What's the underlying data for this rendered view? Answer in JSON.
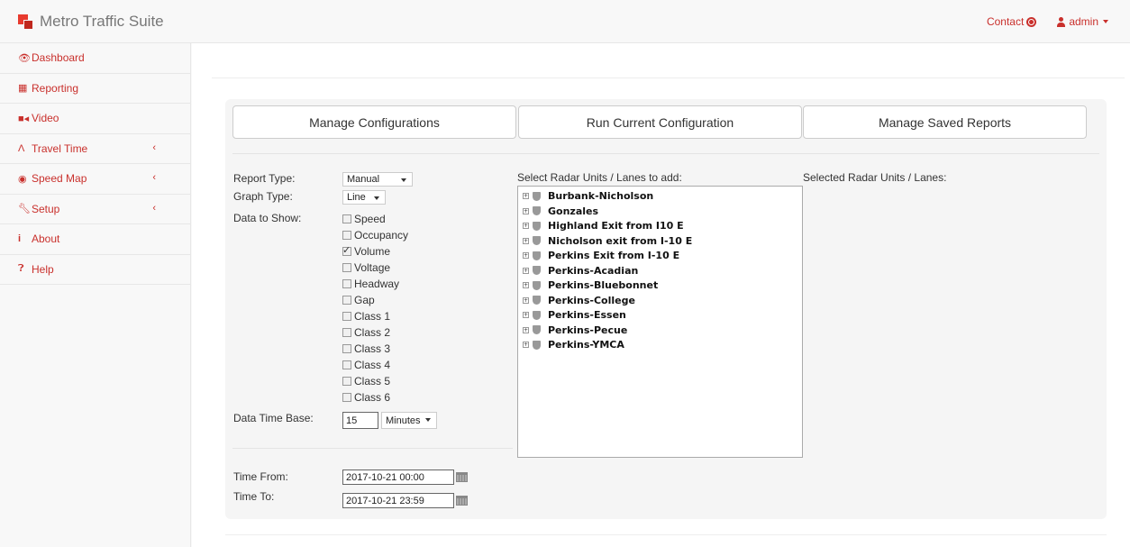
{
  "app": {
    "title": "Metro Traffic Suite"
  },
  "topnav": {
    "contact": "Contact",
    "user": "admin"
  },
  "sidebar": {
    "items": [
      {
        "label": "Dashboard",
        "icon": "eye-icon",
        "has_submenu": false
      },
      {
        "label": "Reporting",
        "icon": "bar-chart-icon",
        "has_submenu": false
      },
      {
        "label": "Video",
        "icon": "video-camera-icon",
        "has_submenu": false
      },
      {
        "label": "Travel Time",
        "icon": "road-icon",
        "has_submenu": true
      },
      {
        "label": "Speed Map",
        "icon": "tachometer-icon",
        "has_submenu": true
      },
      {
        "label": "Setup",
        "icon": "wrench-icon",
        "has_submenu": true
      },
      {
        "label": "About",
        "icon": "info-icon",
        "has_submenu": false
      },
      {
        "label": "Help",
        "icon": "question-circle-icon",
        "has_submenu": false
      }
    ],
    "submenu_glyph": "‹"
  },
  "tabs": [
    {
      "label": "Manage Configurations"
    },
    {
      "label": "Run Current Configuration"
    },
    {
      "label": "Manage Saved Reports"
    }
  ],
  "form": {
    "report_type_label": "Report Type:",
    "report_type_value": "Manual",
    "graph_type_label": "Graph Type:",
    "graph_type_value": "Line",
    "data_to_show_label": "Data to Show:",
    "data_options": [
      {
        "label": "Speed",
        "checked": false
      },
      {
        "label": "Occupancy",
        "checked": false
      },
      {
        "label": "Volume",
        "checked": true
      },
      {
        "label": "Voltage",
        "checked": false
      },
      {
        "label": "Headway",
        "checked": false
      },
      {
        "label": "Gap",
        "checked": false
      },
      {
        "label": "Class 1",
        "checked": false
      },
      {
        "label": "Class 2",
        "checked": false
      },
      {
        "label": "Class 3",
        "checked": false
      },
      {
        "label": "Class 4",
        "checked": false
      },
      {
        "label": "Class 5",
        "checked": false
      },
      {
        "label": "Class 6",
        "checked": false
      }
    ],
    "time_base_label": "Data Time Base:",
    "time_base_value": "15",
    "time_base_unit": "Minutes",
    "time_from_label": "Time From:",
    "time_from_value": "2017-10-21 00:00",
    "time_to_label": "Time To:",
    "time_to_value": "2017-10-21 23:59"
  },
  "radar": {
    "select_label": "Select Radar Units / Lanes to add:",
    "selected_label": "Selected Radar Units / Lanes:",
    "units": [
      "Burbank-Nicholson",
      "Gonzales",
      "Highland Exit from I10 E",
      "Nicholson exit from I-10 E",
      "Perkins Exit from I-10 E",
      "Perkins-Acadian",
      "Perkins-Bluebonnet",
      "Perkins-College",
      "Perkins-Essen",
      "Perkins-Pecue",
      "Perkins-YMCA"
    ]
  },
  "colors": {
    "accent": "#c9302c",
    "logo": "#e83a2e"
  }
}
